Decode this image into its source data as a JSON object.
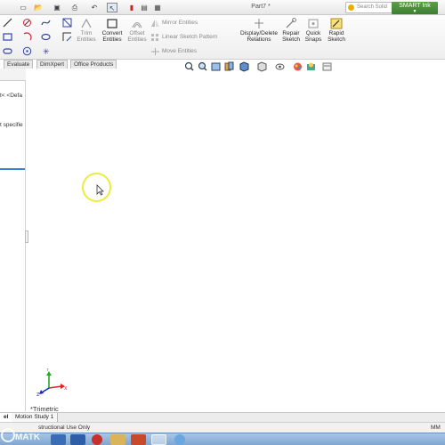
{
  "window": {
    "title": "Part7 *"
  },
  "search": {
    "text": "Search Solid"
  },
  "smart_ink": {
    "label": "SMART Ink"
  },
  "command_manager": {
    "trim": [
      "Trim",
      "Entities"
    ],
    "convert": [
      "Convert",
      "Entities"
    ],
    "offset": [
      "Offset",
      "Entities"
    ],
    "mirror": "Mirror Entities",
    "linear_pattern": "Linear Sketch Pattern",
    "move": "Move Entities",
    "display_delete": [
      "Display/Delete",
      "Relations"
    ],
    "repair": [
      "Repair",
      "Sketch"
    ],
    "quick_snaps": [
      "Quick",
      "Snaps"
    ],
    "rapid_sketch": [
      "Rapid",
      "Sketch"
    ]
  },
  "tabs": [
    "Evaluate",
    "DimXpert",
    "Office Products"
  ],
  "left_panel": {
    "line1": "t< <Defa",
    "line2": "t specifie"
  },
  "view": {
    "orientation_label": "*Trimetric"
  },
  "bottom_tabs": [
    "el",
    "Motion Study 1"
  ],
  "status": {
    "text": "structional Use Only",
    "right": "MM"
  },
  "watermark": {
    "text": "MATK"
  },
  "colors": {
    "smart_ink": "#4a8d3c",
    "cursor_ring": "#ecec3a",
    "axis_x": "#d22",
    "axis_y": "#2a2",
    "axis_z": "#22c",
    "taskbar": "#8fb3dc"
  }
}
